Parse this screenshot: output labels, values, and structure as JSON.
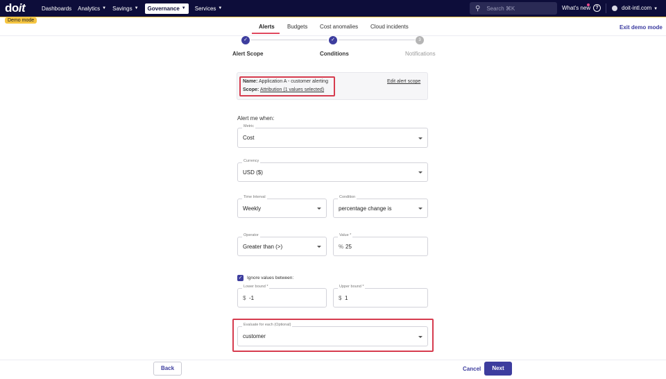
{
  "brand": {
    "logo_left": "do",
    "logo_right": "it"
  },
  "nav": {
    "items": [
      {
        "label": "Dashboards",
        "has_chevron": false
      },
      {
        "label": "Analytics",
        "has_chevron": true
      },
      {
        "label": "Savings",
        "has_chevron": true
      },
      {
        "label": "Governance",
        "has_chevron": true,
        "active": true
      },
      {
        "label": "Services",
        "has_chevron": true
      }
    ],
    "search_placeholder": "Search ⌘K",
    "whats_new": "What's new",
    "help_glyph": "?",
    "org": "doit-intl.com"
  },
  "demo_badge": "Demo mode",
  "tabs": [
    {
      "label": "Alerts",
      "active": true
    },
    {
      "label": "Budgets"
    },
    {
      "label": "Cost anomalies"
    },
    {
      "label": "Cloud incidents"
    }
  ],
  "exit_demo": "Exit demo mode",
  "stepper": {
    "steps": [
      {
        "label": "Alert Scope",
        "state": "done"
      },
      {
        "label": "Conditions",
        "state": "done"
      },
      {
        "label": "Notifications",
        "state": "todo",
        "number": "3"
      }
    ]
  },
  "summary": {
    "name_key": "Name:",
    "name_value": "Application A - customer alerting",
    "scope_key": "Scope:",
    "scope_value": "Attribution (1 values selected)",
    "edit_link": "Edit alert scope"
  },
  "form": {
    "heading": "Alert me when:",
    "metric": {
      "label": "Metric",
      "value": "Cost"
    },
    "currency": {
      "label": "Currency",
      "value": "USD ($)"
    },
    "time_interval": {
      "label": "Time Interval",
      "value": "Weekly"
    },
    "condition": {
      "label": "Condition",
      "value": "percentage change is"
    },
    "operator": {
      "label": "Operator",
      "value": "Greater than (>)"
    },
    "value": {
      "label": "Value *",
      "prefix": "%",
      "value": "25"
    },
    "ignore_values": {
      "label": "Ignore values between:",
      "checked": true
    },
    "lower_bound": {
      "label": "Lower bound *",
      "prefix": "$",
      "value": "-1"
    },
    "upper_bound": {
      "label": "Upper bound *",
      "prefix": "$",
      "value": "1"
    },
    "evaluate_for_each": {
      "label": "Evaluate for each (Optional)",
      "value": "customer"
    }
  },
  "footer": {
    "back": "Back",
    "cancel": "Cancel",
    "next": "Next"
  },
  "colors": {
    "nav_bg": "#0d0d3a",
    "primary": "#3d3d9e",
    "highlight": "#d63b4e",
    "demo": "#f5c542"
  }
}
